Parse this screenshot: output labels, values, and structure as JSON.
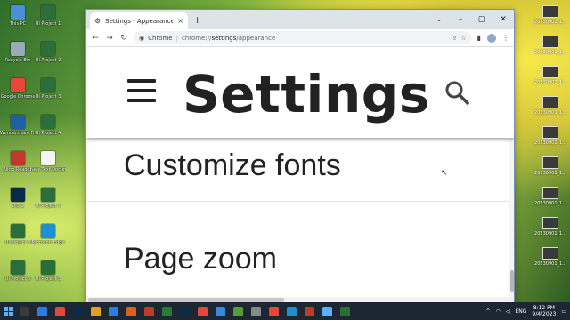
{
  "browser": {
    "tab_title": "Settings - Appearance",
    "omnibox_label": "Chrome",
    "url_prefix": "chrome://",
    "url_bold": "settings",
    "url_suffix": "/appearance"
  },
  "settings": {
    "title": "Settings",
    "rows": [
      "Customize fonts",
      "Page zoom"
    ]
  },
  "desktop_left": [
    {
      "label": "This PC",
      "color": "#4a90d9"
    },
    {
      "label": "UI Project 1",
      "color": "#2c6e3a"
    },
    {
      "label": "Recycle Bin",
      "color": "#9ab"
    },
    {
      "label": "UI Project 2",
      "color": "#2c6e3a"
    },
    {
      "label": "Google Chrome",
      "color": "#e8463a"
    },
    {
      "label": "UI Project 3",
      "color": "#2c6e3a"
    },
    {
      "label": "Wondershare Filmora 11",
      "color": "#1f5fa8"
    },
    {
      "label": "UI Project 4",
      "color": "#2c6e3a"
    },
    {
      "label": "Nitro Reader",
      "color": "#c0392b"
    },
    {
      "label": "New Text Document",
      "color": "#f5f5f5"
    },
    {
      "label": "DIS 1",
      "color": "#0b2a4a"
    },
    {
      "label": "UI Project 7",
      "color": "#2c6e3a"
    },
    {
      "label": "UI Project 5",
      "color": "#2c6e3a"
    },
    {
      "label": "Microsoft Edge",
      "color": "#1e8fd1"
    },
    {
      "label": "UI Project 6",
      "color": "#2c6e3a"
    },
    {
      "label": "UI Project 8",
      "color": "#2c6e3a"
    }
  ],
  "desktop_right": [
    "20230901_1...",
    "20230901_1...",
    "20230901_1...",
    "20230901_1...",
    "20230901_1...",
    "20230901_1...",
    "20230901_1...",
    "20230901_1...",
    "20230901_1..."
  ],
  "taskbar": {
    "apps": [
      "#3a3a3a",
      "#2a7de1",
      "#e8463a",
      "#0b2a4a",
      "#e0a020",
      "#2a7de1",
      "#e06010",
      "#c0392b",
      "#2c7a3a",
      "#0b2a4a",
      "#e8463a",
      "#3a8ad6",
      "#5a9a3a",
      "#888888",
      "#e8463a",
      "#1e8fd1",
      "#c0392b",
      "#5ab0f0",
      "#2c6e3a"
    ],
    "lang": "ENG",
    "time": "8:12 PM",
    "date": "9/4/2023"
  }
}
